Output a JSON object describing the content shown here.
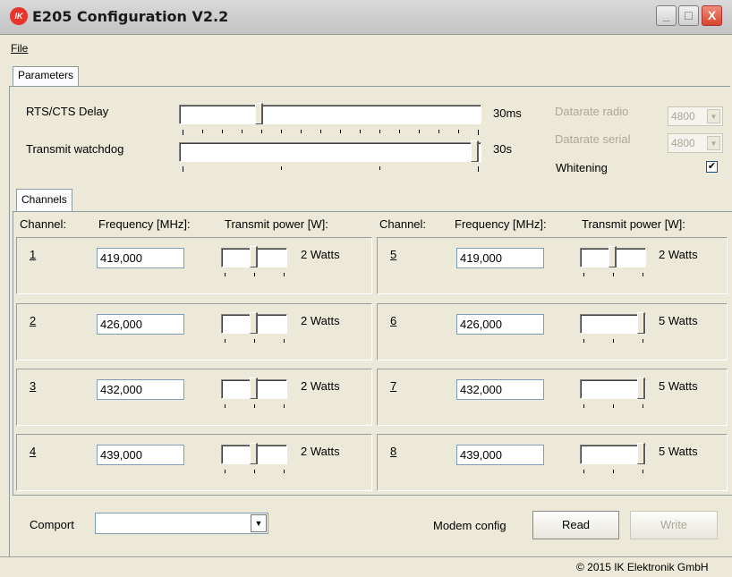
{
  "window": {
    "title": "E205 Configuration V2.2",
    "logo_text": "IK",
    "min_label": "_",
    "max_label": "□",
    "close_label": "X"
  },
  "menu": {
    "file": "File"
  },
  "tabs": {
    "parameters": "Parameters",
    "channels": "Channels"
  },
  "parameters": {
    "rts_label": "RTS/CTS Delay",
    "rts_value": "30ms",
    "rts_level": 0.28,
    "watchdog_label": "Transmit watchdog",
    "watchdog_value": "30s",
    "watchdog_level": 1.0,
    "datarate_radio_label": "Datarate radio",
    "datarate_radio_value": "4800",
    "datarate_serial_label": "Datarate serial",
    "datarate_serial_value": "4800",
    "whitening_label": "Whitening",
    "whitening_checked": true,
    "check_mark": "✔"
  },
  "channels_header": {
    "channel": "Channel:",
    "frequency": "Frequency  [MHz]:",
    "power": "Transmit power [W]:"
  },
  "channels": [
    {
      "num": "1",
      "freq": "419,000",
      "power": "2 Watts",
      "level": 0.5
    },
    {
      "num": "2",
      "freq": "426,000",
      "power": "2 Watts",
      "level": 0.5
    },
    {
      "num": "3",
      "freq": "432,000",
      "power": "2 Watts",
      "level": 0.5
    },
    {
      "num": "4",
      "freq": "439,000",
      "power": "2 Watts",
      "level": 0.5
    },
    {
      "num": "5",
      "freq": "419,000",
      "power": "2 Watts",
      "level": 0.5
    },
    {
      "num": "6",
      "freq": "426,000",
      "power": "5 Watts",
      "level": 1.0
    },
    {
      "num": "7",
      "freq": "432,000",
      "power": "5 Watts",
      "level": 1.0
    },
    {
      "num": "8",
      "freq": "439,000",
      "power": "5 Watts",
      "level": 1.0
    }
  ],
  "bottom": {
    "comport_label": "Comport",
    "comport_value": "",
    "modem_config_label": "Modem config",
    "read_label": "Read",
    "write_label": "Write"
  },
  "status": {
    "copyright": "© 2015 IK Elektronik GmbH"
  },
  "colors": {
    "logo_red": "#e8352b",
    "window_bg": "#ece9d8",
    "close_red": "#d8452a"
  }
}
